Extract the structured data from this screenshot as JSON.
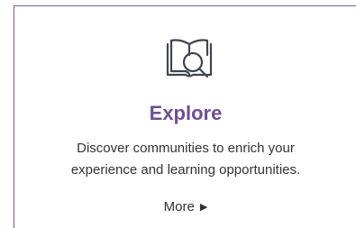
{
  "card": {
    "icon": "book-magnifier-icon",
    "title": "Explore",
    "description_line1": "Discover communities to enrich your",
    "description_line2": "experience and learning opportunities.",
    "more_label": "More",
    "more_icon": "caret-right-icon",
    "accent_color": "#6f4e98",
    "border_color": "#7b5aa6",
    "icon_color": "#3f4650"
  }
}
